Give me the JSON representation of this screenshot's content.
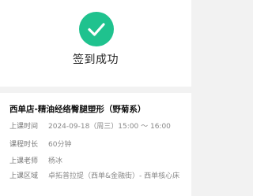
{
  "status": {
    "title": "签到成功",
    "icon": "check-icon",
    "accent_color": "#1fc28e"
  },
  "course": {
    "title": "西单店-精油经络臀腿塑形（野菊系）",
    "fields": [
      {
        "label": "上课时间",
        "value": "2024-09-18（周三）15:00 ～ 16:00"
      },
      {
        "label": "课程时长",
        "value": "60分钟"
      },
      {
        "label": "上课老师",
        "value": "杨冰"
      },
      {
        "label": "上课区域",
        "value": "卓拓普拉提（西单&金融街）- 西单核心床"
      }
    ]
  }
}
